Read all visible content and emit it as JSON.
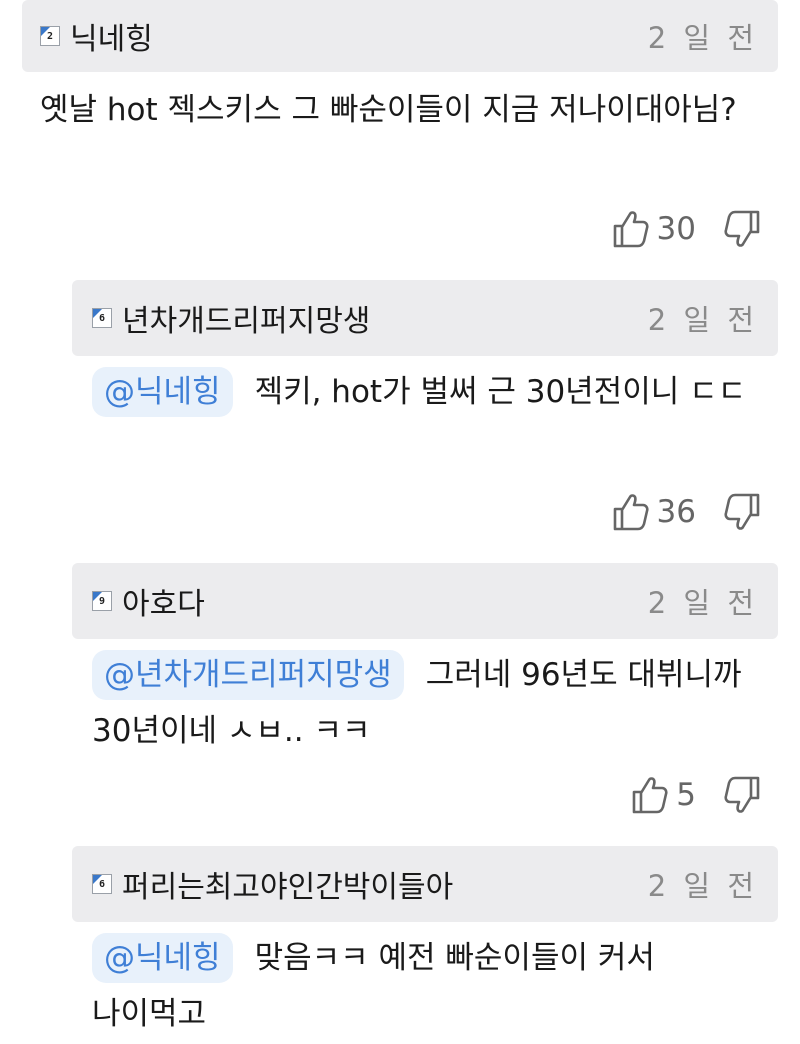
{
  "comment": {
    "level": "2",
    "username": "닉네힝",
    "time": "2 일 전",
    "text": "옛날 hot 젝스키스 그 빠순이들이 지금 저나이대아님?",
    "likes": "30"
  },
  "replies": [
    {
      "level": "6",
      "username": "년차개드리퍼지망생",
      "time": "2 일 전",
      "mention": "@닉네힝",
      "text": "젝키, hot가 벌써 근 30년전이니 ㄷㄷ",
      "likes": "36"
    },
    {
      "level": "9",
      "username": "아호다",
      "time": "2 일 전",
      "mention": "@년차개드리퍼지망생",
      "text": "그러네 96년도 대뷔니까 30년이네 ㅅㅂ.. ㅋㅋ",
      "likes": "5"
    },
    {
      "level": "6",
      "username": "퍼리는최고야인간박이들아",
      "time": "2 일 전",
      "mention": "@닉네힝",
      "text": "맞음ㅋㅋ 예전 빠순이들이 커서 나이먹고"
    }
  ],
  "icons": {
    "like": "thumbs-up-icon",
    "dislike": "thumbs-down-icon",
    "level": "level-badge-icon"
  }
}
